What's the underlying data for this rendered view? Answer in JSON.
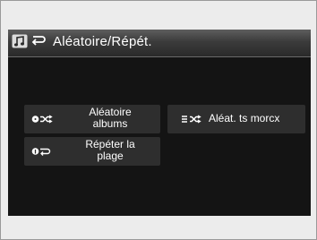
{
  "screen": {
    "title": "Aléatoire/Répét.",
    "title_icons": [
      "music-note-icon",
      "repeat-icon"
    ]
  },
  "options": [
    {
      "label": "Aléatoire albums",
      "line1": "Aléatoire",
      "line2": "albums",
      "icon": "disc-shuffle-icon"
    },
    {
      "label": "Aléat. ts morcx",
      "icon": "list-shuffle-icon"
    },
    {
      "label": "Répéter la plage",
      "line1": "Répéter la",
      "line2": "plage",
      "icon": "track-repeat-icon"
    }
  ]
}
